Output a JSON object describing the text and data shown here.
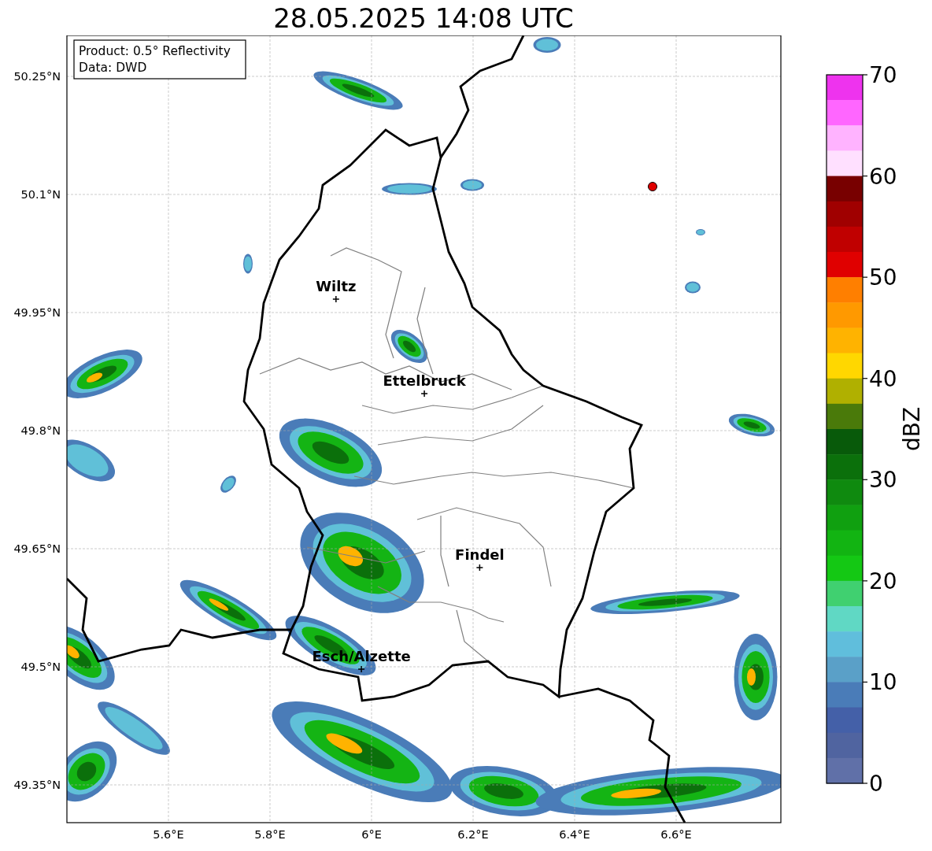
{
  "title": "28.05.2025 14:08 UTC",
  "info_box": {
    "lines": [
      "Product: 0.5° Reflectivity",
      "Data: DWD"
    ]
  },
  "lat_ticks": [
    "50.25°N",
    "50.1°N",
    "49.95°N",
    "49.8°N",
    "49.65°N",
    "49.5°N",
    "49.35°N"
  ],
  "lon_ticks": [
    "5.6°E",
    "5.8°E",
    "6°E",
    "6.2°E",
    "6.4°E",
    "6.6°E"
  ],
  "cities": [
    {
      "name": "Wiltz"
    },
    {
      "name": "Ettelbruck"
    },
    {
      "name": "Findel"
    },
    {
      "name": "Esch/Alzette"
    }
  ],
  "colorbar": {
    "label": "dBZ",
    "ticks": [
      "70",
      "60",
      "50",
      "40",
      "30",
      "20",
      "10",
      "0"
    ],
    "bins": [
      {
        "color": "#ee33ee"
      },
      {
        "color": "#ff66ff"
      },
      {
        "color": "#ffb3ff"
      },
      {
        "color": "#ffe0ff"
      },
      {
        "color": "#780000"
      },
      {
        "color": "#a00000"
      },
      {
        "color": "#c00000"
      },
      {
        "color": "#e00000"
      },
      {
        "color": "#ff7f00"
      },
      {
        "color": "#ff9900"
      },
      {
        "color": "#ffb300"
      },
      {
        "color": "#ffd700"
      },
      {
        "color": "#b0b000"
      },
      {
        "color": "#4a7a0a"
      },
      {
        "color": "#085a0a"
      },
      {
        "color": "#0b700b"
      },
      {
        "color": "#0f8a0f"
      },
      {
        "color": "#10a010"
      },
      {
        "color": "#12b412"
      },
      {
        "color": "#14c814"
      },
      {
        "color": "#40d070"
      },
      {
        "color": "#60d8c4"
      },
      {
        "color": "#60bedc"
      },
      {
        "color": "#5aa0c8"
      },
      {
        "color": "#4a7cb8"
      },
      {
        "color": "#4460a8"
      },
      {
        "color": "#5064a0"
      },
      {
        "color": "#6070a8"
      }
    ]
  }
}
